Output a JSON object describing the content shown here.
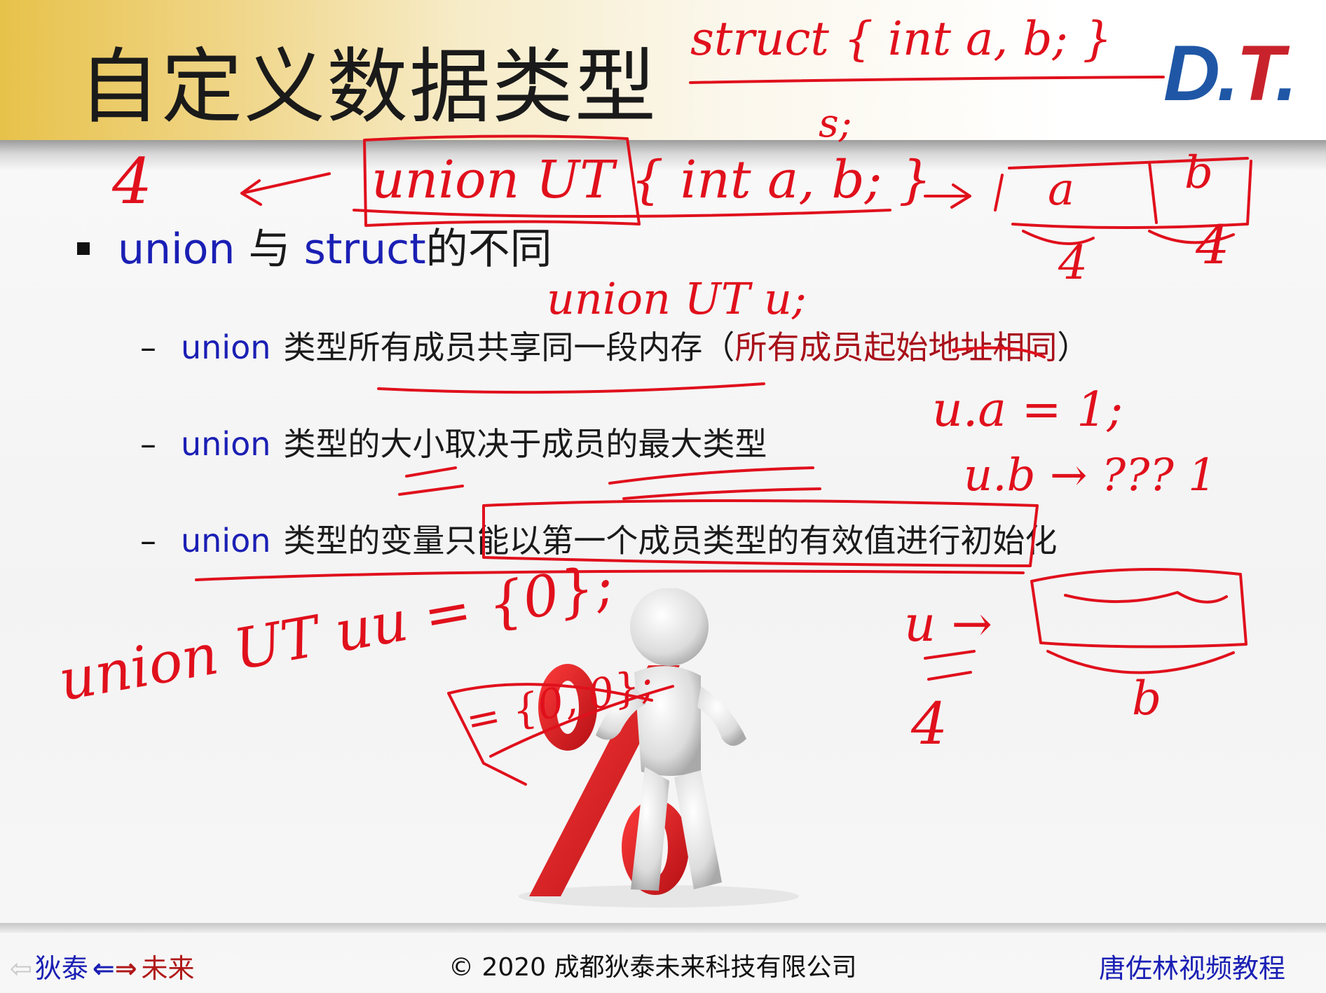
{
  "slide": {
    "title": "自定义数据类型",
    "logo": {
      "text": "D",
      "dot": ".",
      "t": "T",
      "dot2": "."
    }
  },
  "bullet": {
    "kw1": "union",
    "mid": "与",
    "kw2": "struct",
    "tail": "的不同"
  },
  "subpoints": [
    {
      "dash": "–",
      "kw": "union",
      "text": "类型所有成员共享同一段内存",
      "paren_open": "（",
      "note": "所有成员起始地址相同",
      "paren_close": "）"
    },
    {
      "dash": "–",
      "kw": "union",
      "text": "类型的大小取决于成员的最大类型"
    },
    {
      "dash": "–",
      "kw": "union",
      "text": "类型的变量只能以第一个成员类型的有效值进行初始化"
    }
  ],
  "annotations": {
    "struct_decl": "struct { int a, b; }",
    "struct_var": "s;",
    "union_decl": "union UT { int a, b; }",
    "left_num": "4",
    "mem_a": "a",
    "mem_b": "b",
    "size_a": "4",
    "size_b": "4",
    "union_var": "union UT u;",
    "assign": "u.a = 1;",
    "read": "u.b → ??? 1",
    "init": "union UT uu = {0};",
    "bad_init": "= {0, 0};",
    "u_arrow": "u →",
    "u_size": "4",
    "bytes_label": "b"
  },
  "footer": {
    "back": "⇦",
    "left1": "狄泰",
    "arrow_left": "⇐",
    "arrow_right": "⇒",
    "left2": "未来",
    "center": "© 2020 成都狄泰未来科技有限公司",
    "right": "唐佐林视频教程"
  },
  "colors": {
    "title_gold": "#e7c24a",
    "keyword_blue": "#1a1fb4",
    "note_red": "#a8101a",
    "ink_red": "#e0101c"
  }
}
